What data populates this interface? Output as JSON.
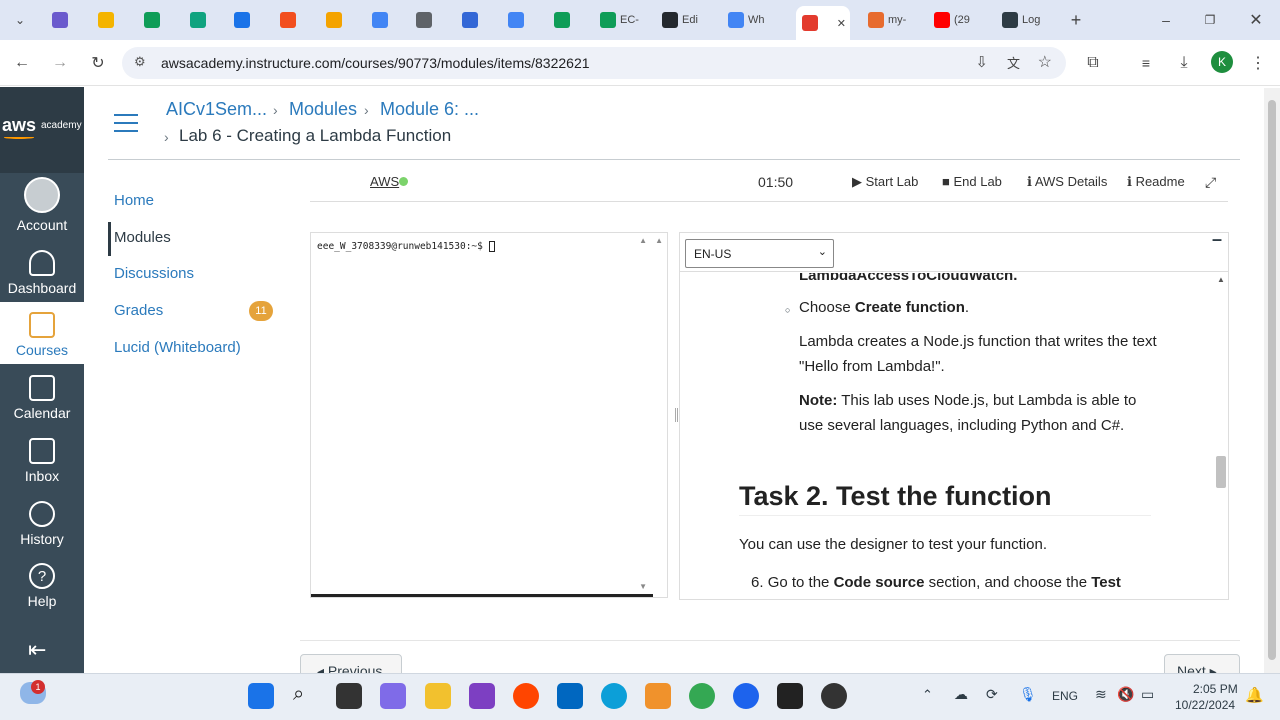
{
  "browser": {
    "tabs": [
      {
        "label": "",
        "color": "#6a5acd"
      },
      {
        "label": "",
        "color": "#f4b400"
      },
      {
        "label": "",
        "color": "#0f9d58"
      },
      {
        "label": "",
        "color": "#10a37f"
      },
      {
        "label": "",
        "color": "#1a73e8"
      },
      {
        "label": "",
        "color": "#f24e1e"
      },
      {
        "label": "",
        "color": "#f4a300"
      },
      {
        "label": "",
        "color": "#4285f4"
      },
      {
        "label": "",
        "color": "#5f6368"
      },
      {
        "label": "",
        "color": "#3367d6"
      },
      {
        "label": "",
        "color": "#4285f4"
      },
      {
        "label": "",
        "color": "#0f9d58"
      },
      {
        "label": "EC-",
        "color": "#0f9d58"
      },
      {
        "label": "Edi",
        "color": "#24292e"
      },
      {
        "label": "Wh",
        "color": "#4285f4"
      },
      {
        "label": "",
        "color": "#e33b2e"
      },
      {
        "label": "my-",
        "color": "#e76b2e"
      },
      {
        "label": "(29",
        "color": "#ff0000"
      },
      {
        "label": "Log",
        "color": "#2d3b45"
      }
    ],
    "url": "awsacademy.instructure.com/courses/90773/modules/items/8322621",
    "profile_initial": "K"
  },
  "global_nav": {
    "logo_text": "aws",
    "logo_sub": "academy",
    "items": [
      {
        "label": "Account"
      },
      {
        "label": "Dashboard"
      },
      {
        "label": "Courses"
      },
      {
        "label": "Calendar"
      },
      {
        "label": "Inbox"
      },
      {
        "label": "History"
      },
      {
        "label": "Help"
      }
    ]
  },
  "breadcrumb": {
    "course": "AICv1Sem...",
    "modules": "Modules",
    "module": "Module 6: ...",
    "page": "Lab 6 - Creating a Lambda Function"
  },
  "course_nav": {
    "items": [
      "Home",
      "Modules",
      "Discussions",
      "Grades",
      "Lucid (Whiteboard)"
    ],
    "grades_badge": "11"
  },
  "lab_toolbar": {
    "aws_label": "AWS",
    "timer": "01:50",
    "start_lab": "Start Lab",
    "end_lab": "End Lab",
    "aws_details": "AWS Details",
    "readme": "Readme"
  },
  "terminal": {
    "prompt": "eee_W_3708339@runweb141530:~$"
  },
  "readme": {
    "language": "EN-US",
    "cut_text": "LambdaAccessToCloudWatch.",
    "choose_prefix": "Choose ",
    "choose_bold": "Create function",
    "choose_suffix": ".",
    "p1": "Lambda creates a Node.js function that writes the text \"Hello from Lambda!\".",
    "note_bold": "Note:",
    "note_text": " This lab uses Node.js, but Lambda is able to use several languages, including Python and C#.",
    "task_heading": "Task 2. Test the function",
    "task_intro": "You can use the designer to test your function.",
    "step6_num": "6.",
    "step6_a": "Go to the ",
    "step6_b": "Code source",
    "step6_c": " section, and choose the ",
    "step6_d": "Test"
  },
  "footer_nav": {
    "previous": "◂ Previous",
    "next": "Next ▸"
  },
  "taskbar": {
    "time": "2:05 PM",
    "date": "10/22/2024",
    "lang": "ENG",
    "notif_badge": "1"
  }
}
